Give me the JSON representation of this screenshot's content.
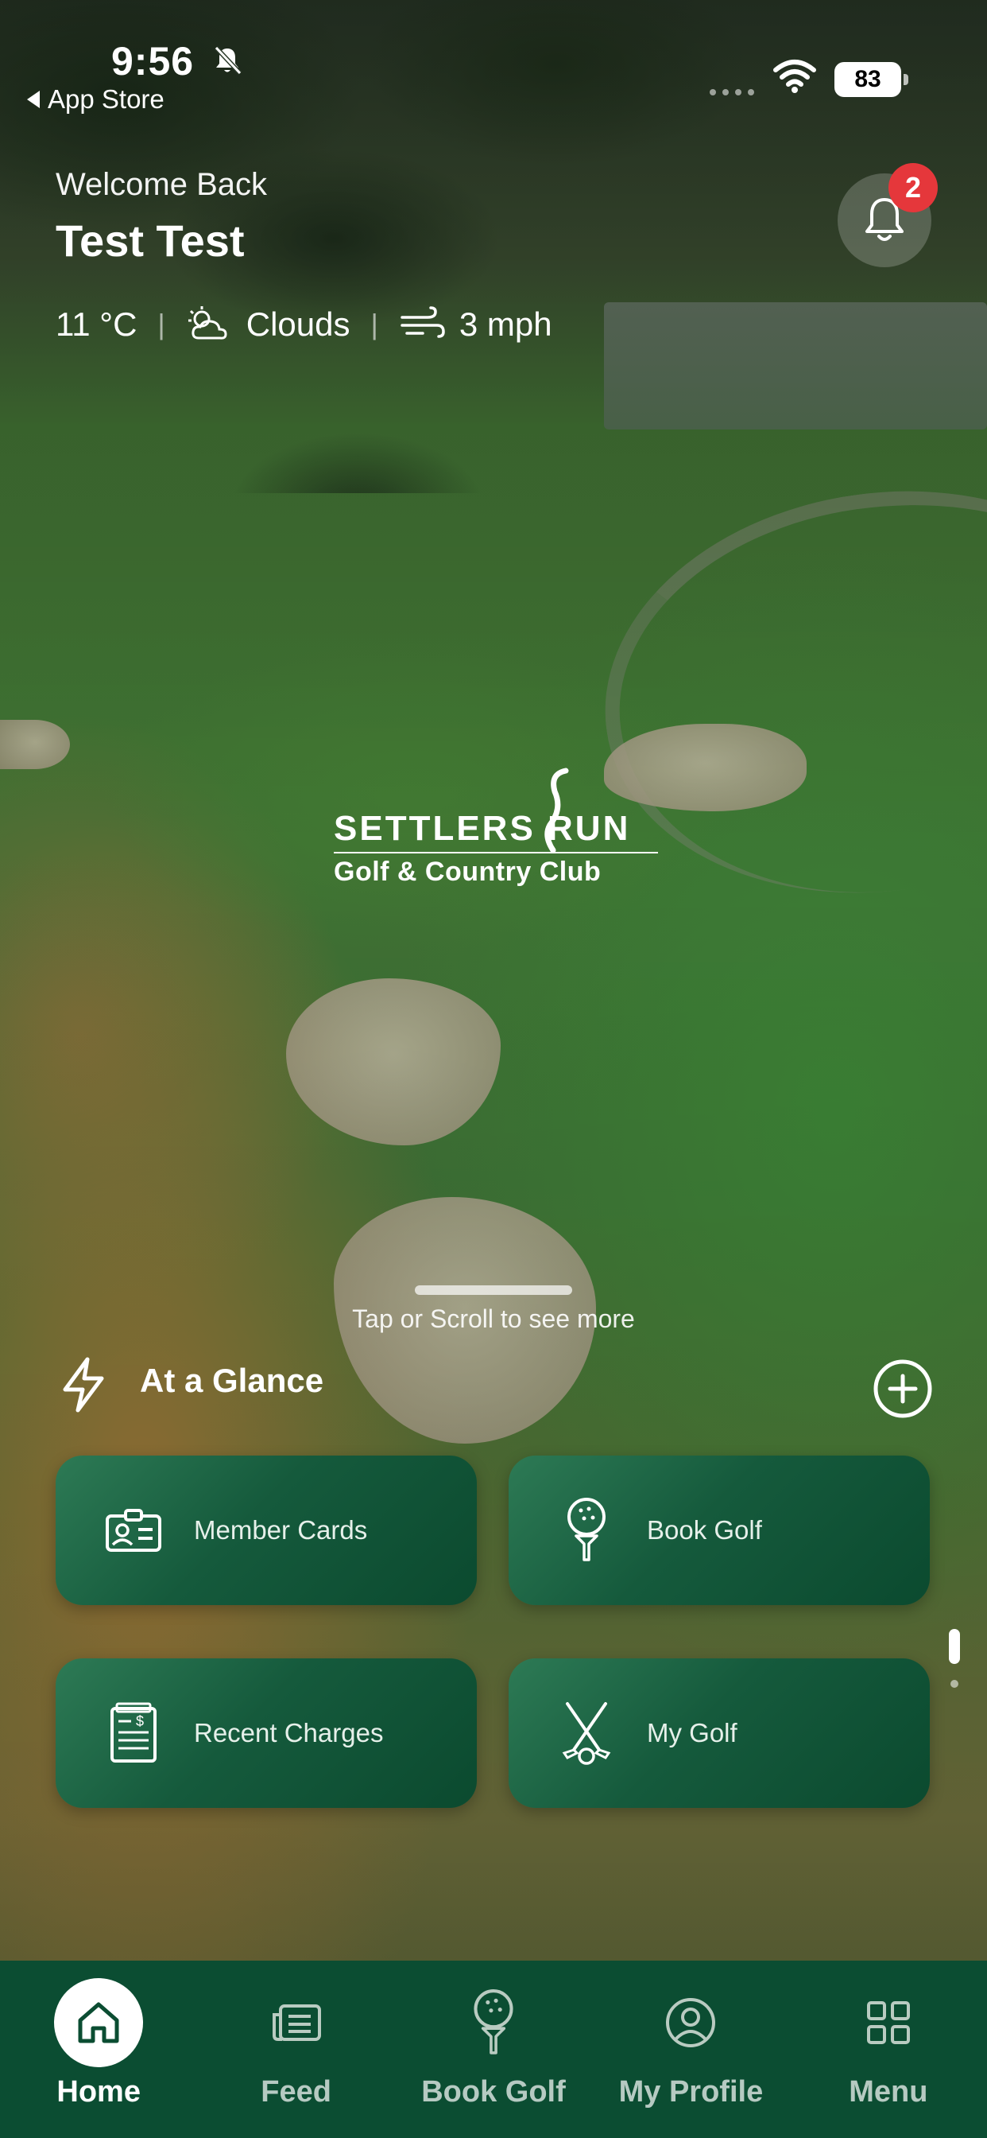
{
  "status_bar": {
    "time": "9:56",
    "back_app": "App Store",
    "battery": "83"
  },
  "header": {
    "welcome": "Welcome Back",
    "user_name": "Test Test",
    "notification_count": "2"
  },
  "weather": {
    "temperature": "11 °C",
    "condition": "Clouds",
    "condition_icon": "cloud-sun-icon",
    "wind": "3 mph",
    "wind_icon": "wind-icon"
  },
  "logo": {
    "line1": "SETTLERS RUN",
    "line2": "Golf & Country Club"
  },
  "scroll_hint": "Tap or Scroll to see more",
  "at_a_glance": {
    "title": "At a Glance",
    "cards": [
      {
        "label": "Member Cards",
        "icon": "id-card-icon"
      },
      {
        "label": "Book Golf",
        "icon": "golf-tee-icon"
      },
      {
        "label": "Recent Charges",
        "icon": "receipt-icon"
      },
      {
        "label": "My Golf",
        "icon": "golf-clubs-icon"
      }
    ]
  },
  "nav": {
    "items": [
      {
        "label": "Home",
        "icon": "home-icon",
        "active": true
      },
      {
        "label": "Feed",
        "icon": "feed-icon"
      },
      {
        "label": "Book Golf",
        "icon": "golf-tee-icon"
      },
      {
        "label": "My Profile",
        "icon": "profile-icon"
      },
      {
        "label": "Menu",
        "icon": "grid-icon"
      }
    ]
  },
  "colors": {
    "card_green": "#155a3c",
    "nav_green": "#0b4d32",
    "badge_red": "#e5373b"
  }
}
